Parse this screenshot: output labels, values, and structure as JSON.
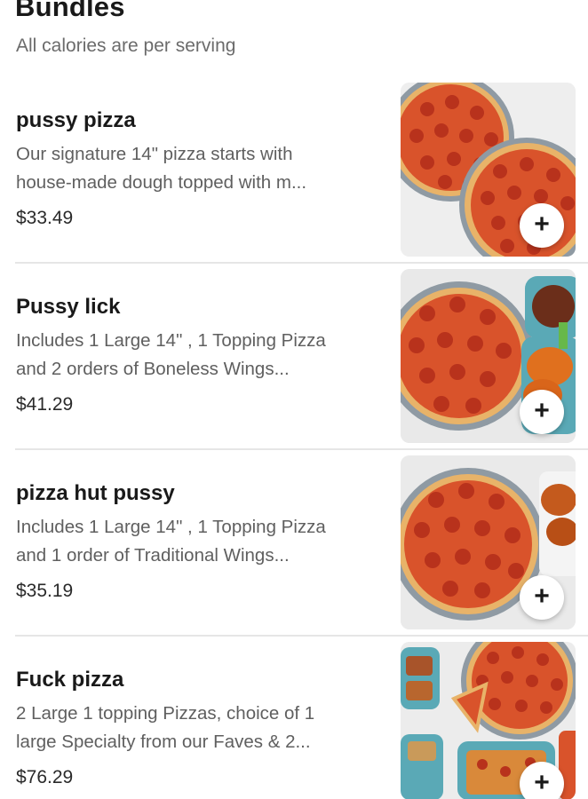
{
  "section": {
    "title": "Bundles",
    "subtitle": "All calories are per serving"
  },
  "items": [
    {
      "name": "pussy pizza",
      "description_lines": [
        "Our signature 14\" pizza starts with",
        "house-made dough topped with m..."
      ],
      "price": "$33.49",
      "add_label": "+",
      "image_icon": "two-pepperoni-pizzas-image"
    },
    {
      "name": "Pussy lick",
      "description_lines": [
        "Includes 1 Large 14\" , 1 Topping Pizza",
        "and 2 orders of Boneless Wings..."
      ],
      "price": "$41.29",
      "add_label": "+",
      "image_icon": "pizza-and-wings-image"
    },
    {
      "name": "pizza hut pussy",
      "description_lines": [
        "Includes 1 Large 14\" , 1 Topping Pizza",
        "and 1 order of Traditional Wings..."
      ],
      "price": "$35.19",
      "add_label": "+",
      "image_icon": "pizza-and-traditional-wings-image"
    },
    {
      "name": "Fuck pizza",
      "description_lines": [
        "2 Large 1 topping Pizzas, choice of 1",
        "large Specialty from our Faves & 2..."
      ],
      "price": "$76.29",
      "add_label": "+",
      "image_icon": "pizza-spread-image"
    }
  ],
  "colors": {
    "pizza_sauce": "#d9532b",
    "pepperoni": "#b8321c",
    "crust": "#e8b369",
    "pan": "#8f9aa3",
    "wings": "#c45a1d"
  }
}
